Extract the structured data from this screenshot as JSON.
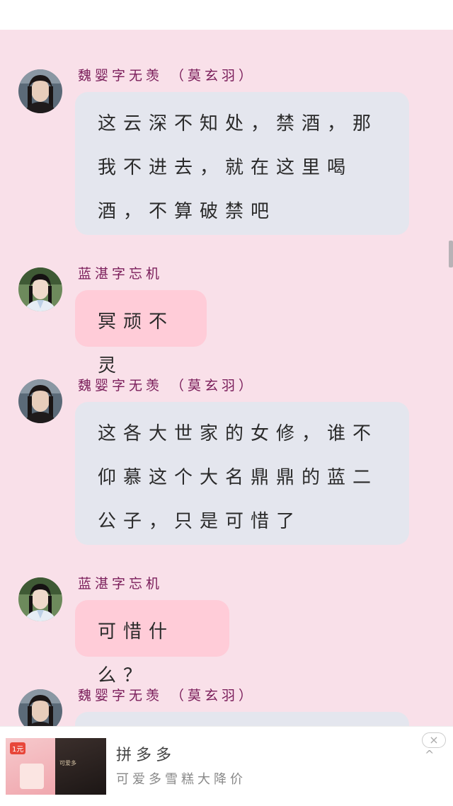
{
  "messages": [
    {
      "speaker": "魏婴字无羡 （莫玄羽）",
      "text": "这云深不知处，禁酒，那我不进去，就在这里喝酒，不算破禁吧",
      "style": "blue"
    },
    {
      "speaker": "蓝湛字忘机",
      "text": "冥顽不灵",
      "style": "pink"
    },
    {
      "speaker": "魏婴字无羡 （莫玄羽）",
      "text": "这各大世家的女修，谁不仰慕这个大名鼎鼎的蓝二公子，只是可惜了",
      "style": "blue"
    },
    {
      "speaker": "蓝湛字忘机",
      "text": "可惜什么？",
      "style": "pink"
    },
    {
      "speaker": "魏婴字无羡 （莫玄羽）",
      "text": "",
      "style": "blue"
    }
  ],
  "ad": {
    "title": "拼多多",
    "subtitle": "可爱多雪糕大降价",
    "badge": "1元",
    "close_icon": "×",
    "collapse_icon": "^",
    "image2_text": "可爱多"
  },
  "colors": {
    "background": "#f9e0e9",
    "blue_bubble": "#e4e6ee",
    "pink_bubble": "#ffccd8",
    "name_color": "#7a1d5a"
  }
}
